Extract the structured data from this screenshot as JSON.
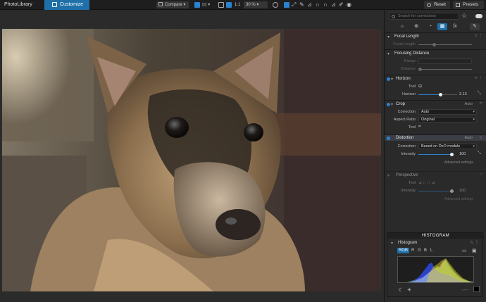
{
  "topbar": {
    "library_tab": "PhotoLibrary",
    "customize_tab": "Customize",
    "compare_label": "Compare",
    "ratio_label": "1:1",
    "zoom_value": "30 %",
    "reset_label": "Reset",
    "presets_label": "Presets"
  },
  "panel": {
    "search_placeholder": "Search for corrections",
    "focal_length": {
      "title": "Focal Length",
      "row_label": "Focal Length"
    },
    "focusing_distance": {
      "title": "Focusing Distance",
      "range_label": "Range",
      "distance_label": "Distance"
    },
    "horizon": {
      "title": "Horizon",
      "tool_label": "Tool",
      "slider_label": "Horizon",
      "value": "2.13",
      "fraction": 0.58
    },
    "crop": {
      "title": "Crop",
      "status": "Auto",
      "correction_label": "Correction",
      "correction_value": "Auto",
      "aspect_label": "Aspect Ratio",
      "aspect_value": "Original",
      "tool_label": "Tool"
    },
    "distortion": {
      "title": "Distortion",
      "status": "Auto",
      "correction_label": "Correction",
      "correction_value": "Based on DxO module",
      "intensity_label": "Intensity",
      "intensity_value": "100",
      "advanced": "Advanced settings"
    },
    "perspective": {
      "title": "Perspective",
      "tool_label": "Tool",
      "intensity_label": "Intensity",
      "intensity_value": "100",
      "advanced": "Advanced settings"
    }
  },
  "histogram": {
    "header": "HISTOGRAM",
    "title": "Histogram",
    "channels": [
      "RGB",
      "R",
      "G",
      "B",
      "L"
    ]
  },
  "colors": {
    "accent": "#1f6fa8",
    "active_blue": "#2a82d0"
  }
}
